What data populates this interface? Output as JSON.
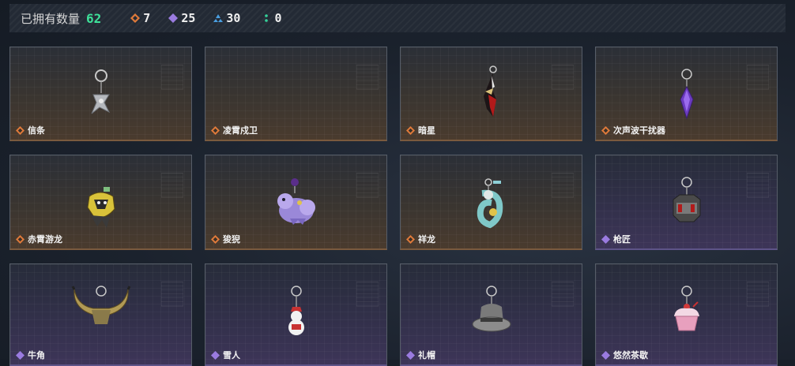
{
  "header": {
    "owned_label": "已拥有数量",
    "owned_count": "62",
    "stats": [
      {
        "icon": "orange-diamond-icon",
        "color": "#e07a3a",
        "value": "7"
      },
      {
        "icon": "purple-diamond-icon",
        "color": "#9a7be0",
        "value": "25"
      },
      {
        "icon": "blue-triangle-icon",
        "color": "#4a9ee0",
        "value": "30"
      },
      {
        "icon": "green-dots-icon",
        "color": "#34d19a",
        "value": "0"
      }
    ]
  },
  "colors": {
    "orange_rarity": "#e07a3a",
    "purple_rarity": "#9a7be0",
    "owned_count": "#3ee29a"
  },
  "items": [
    {
      "name": "信条",
      "rarity": "orange"
    },
    {
      "name": "凌霄戍卫",
      "rarity": "orange"
    },
    {
      "name": "暗星",
      "rarity": "orange"
    },
    {
      "name": "次声波干扰器",
      "rarity": "orange"
    },
    {
      "name": "赤霄游龙",
      "rarity": "orange"
    },
    {
      "name": "狻猊",
      "rarity": "orange"
    },
    {
      "name": "祥龙",
      "rarity": "orange"
    },
    {
      "name": "枪匠",
      "rarity": "purple"
    },
    {
      "name": "牛角",
      "rarity": "purple"
    },
    {
      "name": "雪人",
      "rarity": "purple"
    },
    {
      "name": "礼帽",
      "rarity": "purple"
    },
    {
      "name": "悠然茶歇",
      "rarity": "purple"
    }
  ]
}
